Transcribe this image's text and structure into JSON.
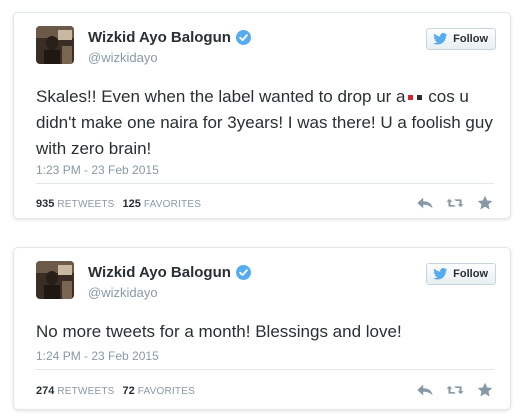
{
  "tweets": [
    {
      "name": "Wizkid Ayo Balogun",
      "handle": "@wizkidayo",
      "follow_label": "Follow",
      "text_before_censor": "Skales!! Even when the label wanted to drop ur a",
      "text_after_censor": " cos u didn't make one naira for 3years! I was there! U a foolish guy with zero brain!",
      "timestamp": "1:23 PM - 23 Feb 2015",
      "retweets": "935",
      "retweets_label": "RETWEETS",
      "favorites": "125",
      "favorites_label": "FAVORITES"
    },
    {
      "name": "Wizkid Ayo Balogun",
      "handle": "@wizkidayo",
      "follow_label": "Follow",
      "text": "No more tweets for a month! Blessings and love!",
      "timestamp": "1:24 PM - 23 Feb 2015",
      "retweets": "274",
      "retweets_label": "RETWEETS",
      "favorites": "72",
      "favorites_label": "FAVORITES"
    }
  ],
  "icons": {
    "verified": "verified-badge-icon",
    "follow": "twitter-bird-icon",
    "reply": "reply-icon",
    "retweet": "retweet-icon",
    "favorite": "favorite-star-icon"
  },
  "colors": {
    "verified_blue": "#55acee",
    "twitter_blue": "#55acee",
    "text": "#292f33",
    "muted": "#8899a6"
  }
}
